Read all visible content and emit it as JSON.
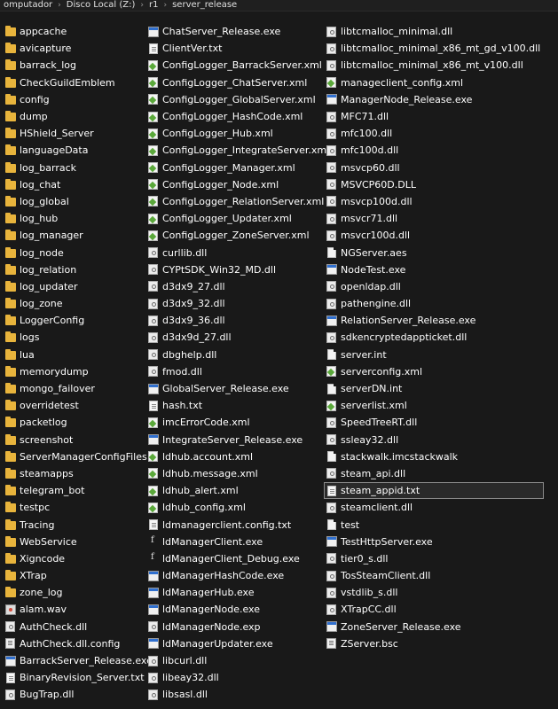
{
  "breadcrumb": [
    "omputador",
    "Disco Local (Z:)",
    "r1",
    "server_release"
  ],
  "columns": [
    [
      {
        "name": "appcache",
        "type": "folder"
      },
      {
        "name": "avicapture",
        "type": "folder"
      },
      {
        "name": "barrack_log",
        "type": "folder"
      },
      {
        "name": "CheckGuildEmblem",
        "type": "folder"
      },
      {
        "name": "config",
        "type": "folder"
      },
      {
        "name": "dump",
        "type": "folder"
      },
      {
        "name": "HShield_Server",
        "type": "folder"
      },
      {
        "name": "languageData",
        "type": "folder"
      },
      {
        "name": "log_barrack",
        "type": "folder"
      },
      {
        "name": "log_chat",
        "type": "folder"
      },
      {
        "name": "log_global",
        "type": "folder"
      },
      {
        "name": "log_hub",
        "type": "folder"
      },
      {
        "name": "log_manager",
        "type": "folder"
      },
      {
        "name": "log_node",
        "type": "folder"
      },
      {
        "name": "log_relation",
        "type": "folder"
      },
      {
        "name": "log_updater",
        "type": "folder"
      },
      {
        "name": "log_zone",
        "type": "folder"
      },
      {
        "name": "LoggerConfig",
        "type": "folder"
      },
      {
        "name": "logs",
        "type": "folder"
      },
      {
        "name": "lua",
        "type": "folder"
      },
      {
        "name": "memorydump",
        "type": "folder"
      },
      {
        "name": "mongo_failover",
        "type": "folder"
      },
      {
        "name": "overridetest",
        "type": "folder"
      },
      {
        "name": "packetlog",
        "type": "folder"
      },
      {
        "name": "screenshot",
        "type": "folder"
      },
      {
        "name": "ServerManagerConfigFiles",
        "type": "folder"
      },
      {
        "name": "steamapps",
        "type": "folder"
      },
      {
        "name": "telegram_bot",
        "type": "folder"
      },
      {
        "name": "testpc",
        "type": "folder"
      },
      {
        "name": "Tracing",
        "type": "folder"
      },
      {
        "name": "WebService",
        "type": "folder"
      },
      {
        "name": "Xigncode",
        "type": "folder"
      },
      {
        "name": "XTrap",
        "type": "folder"
      },
      {
        "name": "zone_log",
        "type": "folder"
      },
      {
        "name": "alam.wav",
        "type": "wav"
      },
      {
        "name": "AuthCheck.dll",
        "type": "dll"
      },
      {
        "name": "AuthCheck.dll.config",
        "type": "doc"
      },
      {
        "name": "BarrackServer_Release.exe",
        "type": "exe"
      },
      {
        "name": "BinaryRevision_Server.txt",
        "type": "txt"
      },
      {
        "name": "BugTrap.dll",
        "type": "dll"
      }
    ],
    [
      {
        "name": "ChatServer_Release.exe",
        "type": "exe"
      },
      {
        "name": "ClientVer.txt",
        "type": "txt"
      },
      {
        "name": "ConfigLogger_BarrackServer.xml",
        "type": "xml"
      },
      {
        "name": "ConfigLogger_ChatServer.xml",
        "type": "xml"
      },
      {
        "name": "ConfigLogger_GlobalServer.xml",
        "type": "xml"
      },
      {
        "name": "ConfigLogger_HashCode.xml",
        "type": "xml"
      },
      {
        "name": "ConfigLogger_Hub.xml",
        "type": "xml"
      },
      {
        "name": "ConfigLogger_IntegrateServer.xml",
        "type": "xml"
      },
      {
        "name": "ConfigLogger_Manager.xml",
        "type": "xml"
      },
      {
        "name": "ConfigLogger_Node.xml",
        "type": "xml"
      },
      {
        "name": "ConfigLogger_RelationServer.xml",
        "type": "xml"
      },
      {
        "name": "ConfigLogger_Updater.xml",
        "type": "xml"
      },
      {
        "name": "ConfigLogger_ZoneServer.xml",
        "type": "xml"
      },
      {
        "name": "curllib.dll",
        "type": "dll"
      },
      {
        "name": "CYPtSDK_Win32_MD.dll",
        "type": "dll"
      },
      {
        "name": "d3dx9_27.dll",
        "type": "dll"
      },
      {
        "name": "d3dx9_32.dll",
        "type": "dll"
      },
      {
        "name": "d3dx9_36.dll",
        "type": "dll"
      },
      {
        "name": "d3dx9d_27.dll",
        "type": "dll"
      },
      {
        "name": "dbghelp.dll",
        "type": "dll"
      },
      {
        "name": "fmod.dll",
        "type": "dll"
      },
      {
        "name": "GlobalServer_Release.exe",
        "type": "exe"
      },
      {
        "name": "hash.txt",
        "type": "txt"
      },
      {
        "name": "imcErrorCode.xml",
        "type": "xml"
      },
      {
        "name": "IntegrateServer_Release.exe",
        "type": "exe"
      },
      {
        "name": "ldhub.account.xml",
        "type": "xml"
      },
      {
        "name": "ldhub.message.xml",
        "type": "xml"
      },
      {
        "name": "ldhub_alert.xml",
        "type": "xml"
      },
      {
        "name": "ldhub_config.xml",
        "type": "xml"
      },
      {
        "name": "ldmanagerclient.config.txt",
        "type": "txt"
      },
      {
        "name": "ldManagerClient.exe",
        "type": "app"
      },
      {
        "name": "ldManagerClient_Debug.exe",
        "type": "app"
      },
      {
        "name": "ldManagerHashCode.exe",
        "type": "exe"
      },
      {
        "name": "ldManagerHub.exe",
        "type": "exe"
      },
      {
        "name": "ldManagerNode.exe",
        "type": "exe"
      },
      {
        "name": "ldManagerNode.exp",
        "type": "dll"
      },
      {
        "name": "ldManagerUpdater.exe",
        "type": "exe"
      },
      {
        "name": "libcurl.dll",
        "type": "dll"
      },
      {
        "name": "libeay32.dll",
        "type": "dll"
      },
      {
        "name": "libsasl.dll",
        "type": "dll"
      }
    ],
    [
      {
        "name": "libtcmalloc_minimal.dll",
        "type": "dll"
      },
      {
        "name": "libtcmalloc_minimal_x86_mt_gd_v100.dll",
        "type": "dll"
      },
      {
        "name": "libtcmalloc_minimal_x86_mt_v100.dll",
        "type": "dll"
      },
      {
        "name": "manageclient_config.xml",
        "type": "xml"
      },
      {
        "name": "ManagerNode_Release.exe",
        "type": "exe"
      },
      {
        "name": "MFC71.dll",
        "type": "dll"
      },
      {
        "name": "mfc100.dll",
        "type": "dll"
      },
      {
        "name": "mfc100d.dll",
        "type": "dll"
      },
      {
        "name": "msvcp60.dll",
        "type": "dll"
      },
      {
        "name": "MSVCP60D.DLL",
        "type": "dll"
      },
      {
        "name": "msvcp100d.dll",
        "type": "dll"
      },
      {
        "name": "msvcr71.dll",
        "type": "dll"
      },
      {
        "name": "msvcr100d.dll",
        "type": "dll"
      },
      {
        "name": "NGServer.aes",
        "type": "file"
      },
      {
        "name": "NodeTest.exe",
        "type": "exe"
      },
      {
        "name": "openldap.dll",
        "type": "dll"
      },
      {
        "name": "pathengine.dll",
        "type": "dll"
      },
      {
        "name": "RelationServer_Release.exe",
        "type": "exe"
      },
      {
        "name": "sdkencryptedappticket.dll",
        "type": "dll"
      },
      {
        "name": "server.int",
        "type": "file"
      },
      {
        "name": "serverconfig.xml",
        "type": "xml"
      },
      {
        "name": "serverDN.int",
        "type": "file"
      },
      {
        "name": "serverlist.xml",
        "type": "xml"
      },
      {
        "name": "SpeedTreeRT.dll",
        "type": "dll"
      },
      {
        "name": "ssleay32.dll",
        "type": "dll"
      },
      {
        "name": "stackwalk.imcstackwalk",
        "type": "file"
      },
      {
        "name": "steam_api.dll",
        "type": "dll"
      },
      {
        "name": "steam_appid.txt",
        "type": "txt",
        "selected": true
      },
      {
        "name": "steamclient.dll",
        "type": "dll"
      },
      {
        "name": "test",
        "type": "file"
      },
      {
        "name": "TestHttpServer.exe",
        "type": "exe"
      },
      {
        "name": "tier0_s.dll",
        "type": "dll"
      },
      {
        "name": "TosSteamClient.dll",
        "type": "dll"
      },
      {
        "name": "vstdlib_s.dll",
        "type": "dll"
      },
      {
        "name": "XTrapCC.dll",
        "type": "dll"
      },
      {
        "name": "ZoneServer_Release.exe",
        "type": "exe"
      },
      {
        "name": "ZServer.bsc",
        "type": "doc"
      }
    ]
  ]
}
